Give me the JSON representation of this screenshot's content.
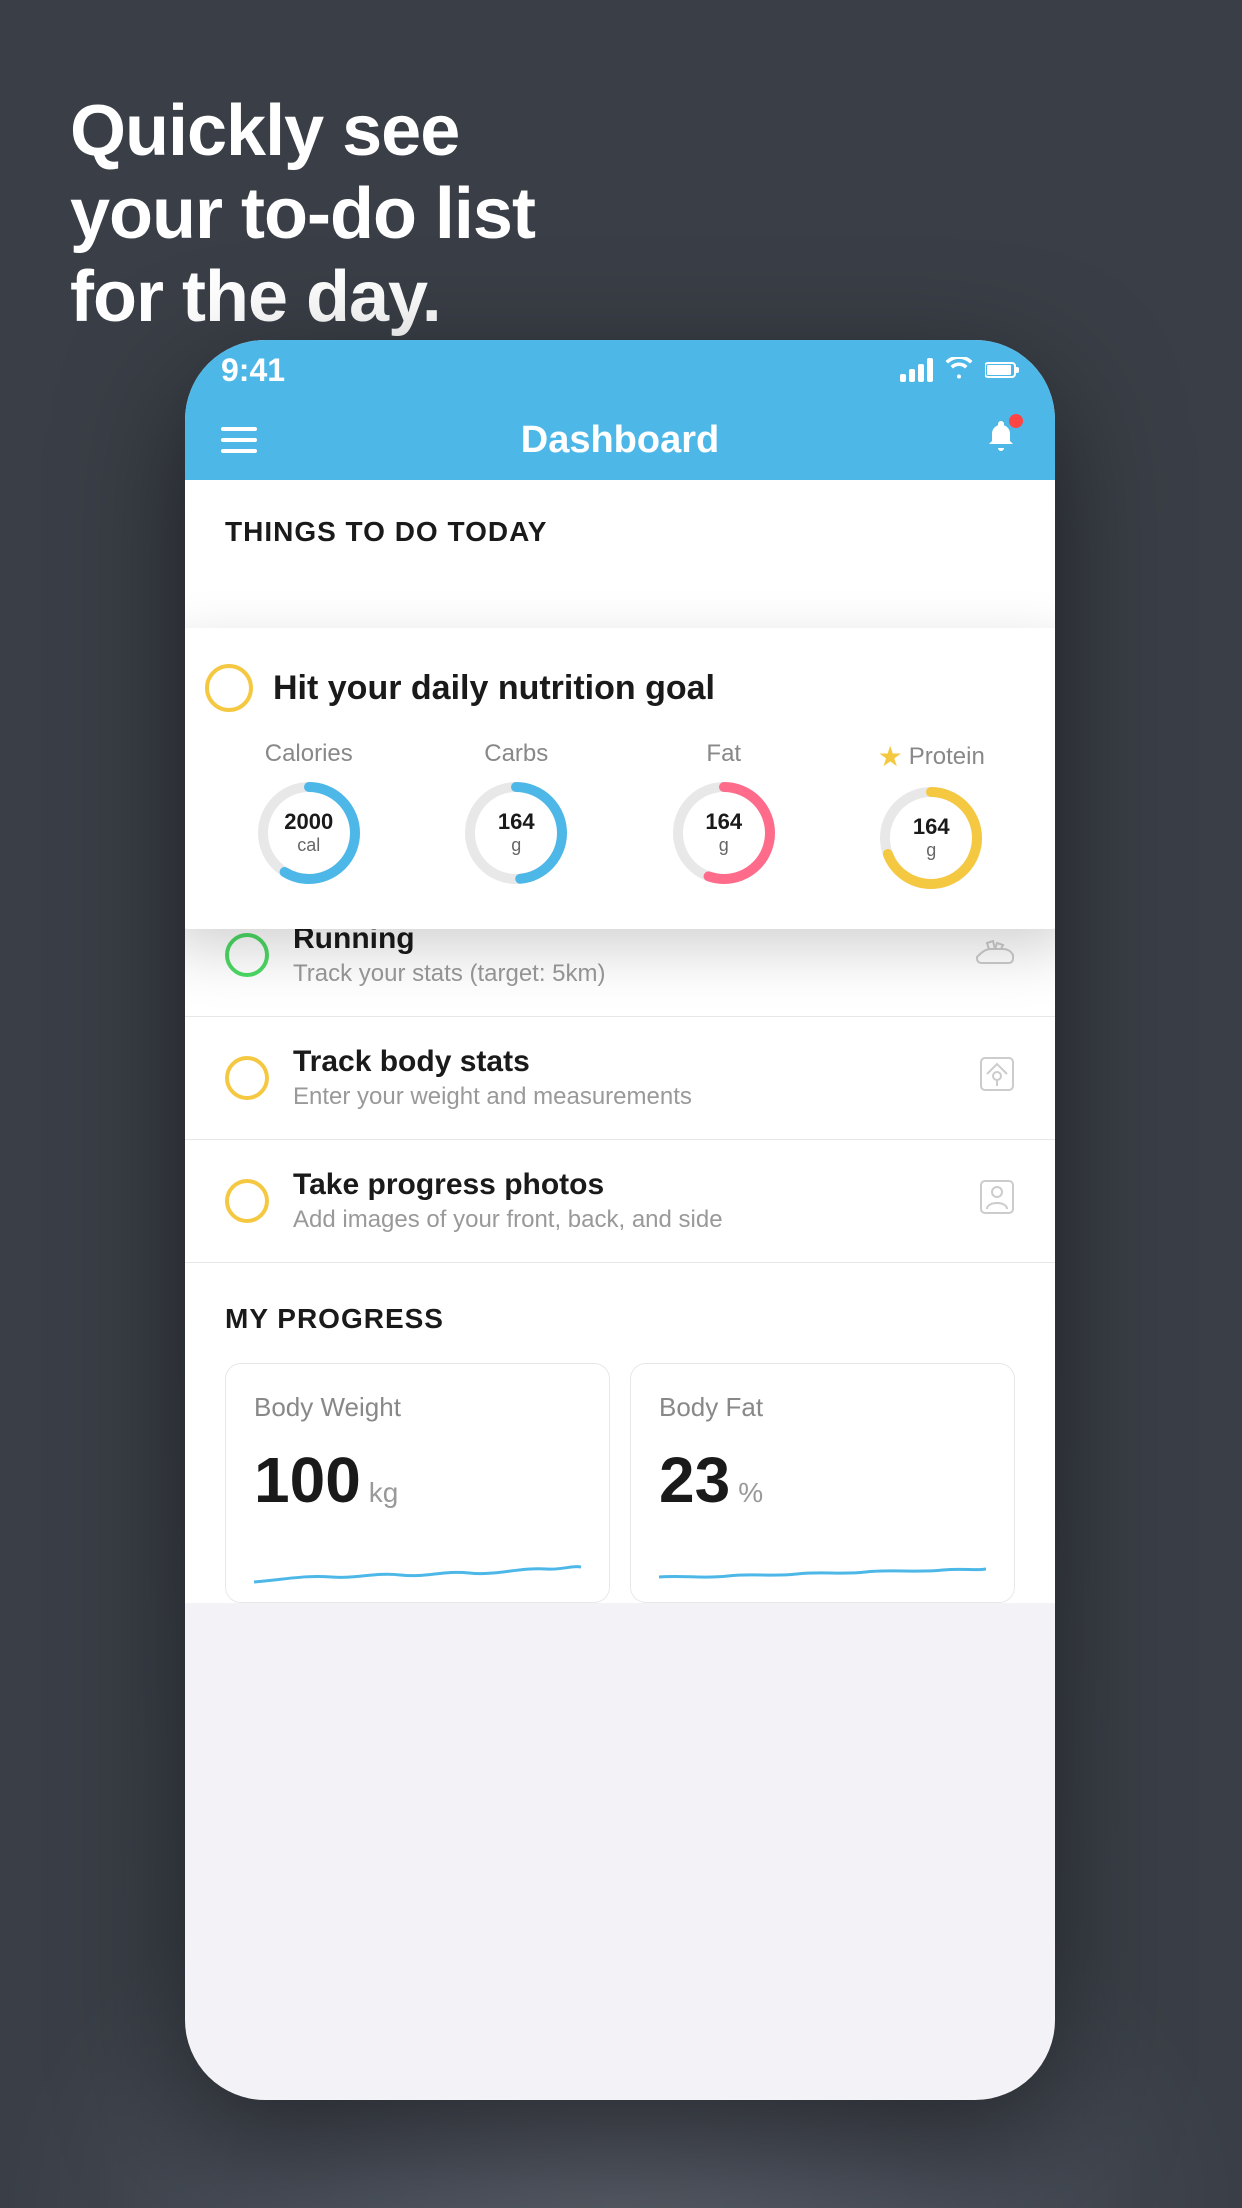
{
  "background": {
    "color": "#3a3f47"
  },
  "headline": {
    "line1": "Quickly see",
    "line2": "your to-do list",
    "line3": "for the day."
  },
  "phone": {
    "status_bar": {
      "time": "9:41",
      "signal_bars": [
        1,
        2,
        3,
        4
      ],
      "wifi": "wifi",
      "battery": "battery"
    },
    "nav_bar": {
      "title": "Dashboard",
      "menu_icon": "hamburger",
      "notification_icon": "bell"
    },
    "section_header": "THINGS TO DO TODAY",
    "featured_card": {
      "circle_type": "yellow-outline",
      "title": "Hit your daily nutrition goal",
      "nutrition": [
        {
          "label": "Calories",
          "value": "2000",
          "unit": "cal",
          "color": "#4db8e8",
          "star": false
        },
        {
          "label": "Carbs",
          "value": "164",
          "unit": "g",
          "color": "#4db8e8",
          "star": false
        },
        {
          "label": "Fat",
          "value": "164",
          "unit": "g",
          "color": "#ff6b8a",
          "star": false
        },
        {
          "label": "Protein",
          "value": "164",
          "unit": "g",
          "color": "#f5c842",
          "star": true
        }
      ]
    },
    "todo_items": [
      {
        "circle_color": "green",
        "title": "Running",
        "subtitle": "Track your stats (target: 5km)",
        "icon": "shoe"
      },
      {
        "circle_color": "yellow",
        "title": "Track body stats",
        "subtitle": "Enter your weight and measurements",
        "icon": "scale"
      },
      {
        "circle_color": "yellow",
        "title": "Take progress photos",
        "subtitle": "Add images of your front, back, and side",
        "icon": "person"
      }
    ],
    "progress_section": {
      "header": "MY PROGRESS",
      "cards": [
        {
          "title": "Body Weight",
          "value": "100",
          "unit": "kg"
        },
        {
          "title": "Body Fat",
          "value": "23",
          "unit": "%"
        }
      ]
    }
  }
}
